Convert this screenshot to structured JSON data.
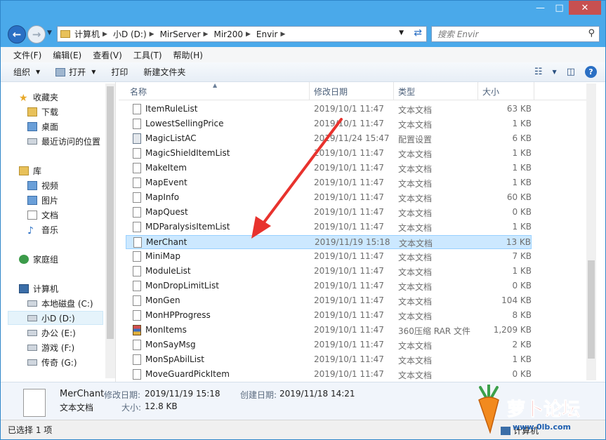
{
  "window": {
    "caption_minimize": "—",
    "caption_maximize": "□",
    "caption_close": "✕"
  },
  "address": {
    "crumbs": [
      "计算机",
      "小D (D:)",
      "MirServer",
      "Mir200",
      "Envir"
    ],
    "search_placeholder": "搜索 Envir"
  },
  "menu": [
    "文件(F)",
    "编辑(E)",
    "查看(V)",
    "工具(T)",
    "帮助(H)"
  ],
  "toolbar": {
    "organize": "组织",
    "open": "打开",
    "print": "打印",
    "new_folder": "新建文件夹",
    "help": "?"
  },
  "nav": {
    "favorites": "收藏夹",
    "downloads": "下载",
    "desktop": "桌面",
    "recent": "最近访问的位置",
    "libraries": "库",
    "videos": "视频",
    "pictures": "图片",
    "documents": "文档",
    "music": "音乐",
    "homegroup": "家庭组",
    "computer": "计算机",
    "drive_c": "本地磁盘 (C:)",
    "drive_d": "小D (D:)",
    "drive_e": "办公 (E:)",
    "drive_f": "游戏 (F:)",
    "drive_g": "传奇 (G:)"
  },
  "columns": {
    "name": "名称",
    "date": "修改日期",
    "type": "类型",
    "size": "大小"
  },
  "files": [
    {
      "name": "ItemRuleList",
      "date": "2019/10/1 11:47",
      "type": "文本文档",
      "size": "63 KB",
      "icon": "text-file-icon"
    },
    {
      "name": "LowestSellingPrice",
      "date": "2019/10/1 11:47",
      "type": "文本文档",
      "size": "1 KB",
      "icon": "text-file-icon"
    },
    {
      "name": "MagicListAC",
      "date": "2019/11/24 15:47",
      "type": "配置设置",
      "size": "6 KB",
      "icon": "config-file-icon"
    },
    {
      "name": "MagicShieldItemList",
      "date": "2019/10/1 11:47",
      "type": "文本文档",
      "size": "1 KB",
      "icon": "text-file-icon"
    },
    {
      "name": "MakeItem",
      "date": "2019/10/1 11:47",
      "type": "文本文档",
      "size": "1 KB",
      "icon": "text-file-icon"
    },
    {
      "name": "MapEvent",
      "date": "2019/10/1 11:47",
      "type": "文本文档",
      "size": "1 KB",
      "icon": "text-file-icon"
    },
    {
      "name": "MapInfo",
      "date": "2019/10/1 11:47",
      "type": "文本文档",
      "size": "60 KB",
      "icon": "text-file-icon"
    },
    {
      "name": "MapQuest",
      "date": "2019/10/1 11:47",
      "type": "文本文档",
      "size": "0 KB",
      "icon": "text-file-icon"
    },
    {
      "name": "MDParalysisItemList",
      "date": "2019/10/1 11:47",
      "type": "文本文档",
      "size": "1 KB",
      "icon": "text-file-icon"
    },
    {
      "name": "MerChant",
      "date": "2019/11/19 15:18",
      "type": "文本文档",
      "size": "13 KB",
      "icon": "text-file-icon",
      "selected": true
    },
    {
      "name": "MiniMap",
      "date": "2019/10/1 11:47",
      "type": "文本文档",
      "size": "7 KB",
      "icon": "text-file-icon"
    },
    {
      "name": "ModuleList",
      "date": "2019/10/1 11:47",
      "type": "文本文档",
      "size": "1 KB",
      "icon": "text-file-icon"
    },
    {
      "name": "MonDropLimitList",
      "date": "2019/10/1 11:47",
      "type": "文本文档",
      "size": "0 KB",
      "icon": "text-file-icon"
    },
    {
      "name": "MonGen",
      "date": "2019/10/1 11:47",
      "type": "文本文档",
      "size": "104 KB",
      "icon": "text-file-icon"
    },
    {
      "name": "MonHPProgress",
      "date": "2019/10/1 11:47",
      "type": "文本文档",
      "size": "8 KB",
      "icon": "text-file-icon"
    },
    {
      "name": "MonItems",
      "date": "2019/10/1 11:47",
      "type": "360压缩 RAR 文件",
      "size": "1,209 KB",
      "icon": "rar-archive-icon"
    },
    {
      "name": "MonSayMsg",
      "date": "2019/10/1 11:47",
      "type": "文本文档",
      "size": "2 KB",
      "icon": "text-file-icon"
    },
    {
      "name": "MonSpAbilList",
      "date": "2019/10/1 11:47",
      "type": "文本文档",
      "size": "1 KB",
      "icon": "text-file-icon"
    },
    {
      "name": "MoveGuardPickItem",
      "date": "2019/10/1 11:47",
      "type": "文本文档",
      "size": "0 KB",
      "icon": "text-file-icon"
    }
  ],
  "details": {
    "name": "MerChant",
    "type": "文本文档",
    "modified_label": "修改日期:",
    "modified_value": "2019/11/19 15:18",
    "created_label": "创建日期:",
    "created_value": "2019/11/18 14:21",
    "size_label": "大小:",
    "size_value": "12.8 KB"
  },
  "status": {
    "left": "已选择 1 项",
    "right": "计算机"
  },
  "watermark": {
    "text": "萝卜论坛",
    "url": "www.0lb.com"
  },
  "colors": {
    "chrome": "#4aa9ea",
    "selection": "#cce8ff",
    "annotation_arrow": "#e8322d"
  }
}
